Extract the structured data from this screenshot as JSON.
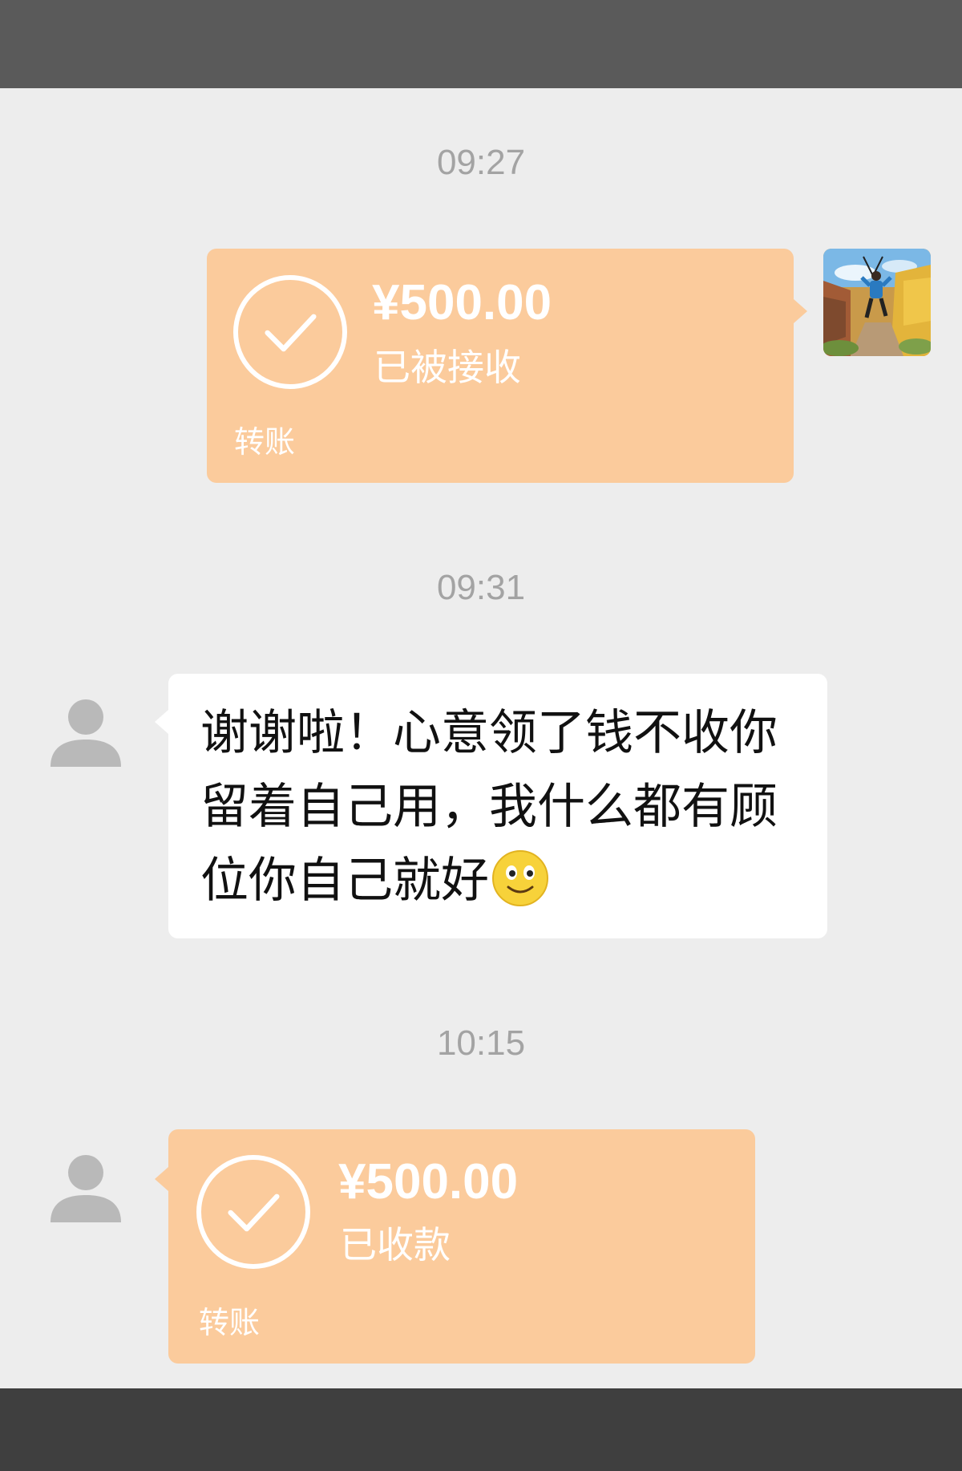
{
  "messages": [
    {
      "time": "09:27",
      "transfer": {
        "amount": "¥500.00",
        "status": "已被接收",
        "label": "转账"
      }
    },
    {
      "time": "09:31",
      "text_lines": [
        "谢谢啦！心意领了钱不收你",
        "留着自己用，我什么都有顾",
        "位你自己就好"
      ],
      "emoji": "smiley-emoji"
    },
    {
      "time": "10:15",
      "transfer": {
        "amount": "¥500.00",
        "status": "已收款",
        "label": "转账"
      }
    }
  ],
  "colors": {
    "chat_background": "#ededed",
    "transfer_bubble": "#fbcb9c",
    "timestamp": "#a3a3a3",
    "text_bubble": "#ffffff"
  }
}
